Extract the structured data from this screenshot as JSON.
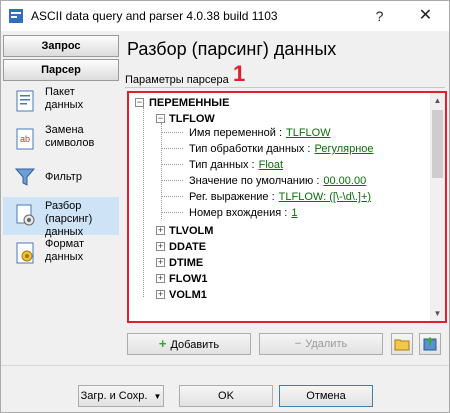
{
  "window": {
    "title": "ASCII data query and parser 4.0.38 build 1103",
    "help_glyph": "?",
    "close_glyph": "✕"
  },
  "sidebar": {
    "tabs": [
      {
        "label": "Запрос"
      },
      {
        "label": "Парсер"
      }
    ],
    "items": [
      {
        "label": "Пакет\nданных",
        "icon": "data-packet-icon"
      },
      {
        "label": "Замена\nсимволов",
        "icon": "replace-chars-icon"
      },
      {
        "label": "Фильтр",
        "icon": "filter-icon"
      },
      {
        "label": "Разбор\n(парсинг)\nданных",
        "icon": "parsing-icon",
        "active": true
      },
      {
        "label": "Формат\nданных",
        "icon": "data-format-icon"
      }
    ]
  },
  "main": {
    "heading": "Разбор (парсинг) данных",
    "group_label": "Параметры парсера",
    "marker": "1"
  },
  "tree": {
    "root": {
      "label": "ПЕРЕМЕННЫЕ",
      "expander": "−"
    },
    "expanded": {
      "label": "TLFLOW",
      "expander": "−"
    },
    "props": [
      {
        "name": "Имя переменной :",
        "value": "TLFLOW"
      },
      {
        "name": "Тип обработки данных :",
        "value": "Регулярное"
      },
      {
        "name": "Тип данных :",
        "value": "Float"
      },
      {
        "name": "Значение по умолчанию :",
        "value": "00.00.00"
      },
      {
        "name": "Рег. выражение :",
        "value": "TLFLOW: ([\\-\\d\\.]+)"
      },
      {
        "name": "Номер вхождения :",
        "value": "1"
      }
    ],
    "collapsed": [
      {
        "label": "TLVOLM",
        "expander": "+"
      },
      {
        "label": "DDATE",
        "expander": "+"
      },
      {
        "label": "DTIME",
        "expander": "+"
      },
      {
        "label": "FLOW1",
        "expander": "+"
      },
      {
        "label": "VOLM1",
        "expander": "+"
      }
    ]
  },
  "actions": {
    "add": "Добавить",
    "delete": "Удалить",
    "add_glyph": "+",
    "delete_glyph": "−"
  },
  "footer": {
    "load_save": "Загр. и Сохр.",
    "load_save_arrow": "▼",
    "ok": "OK",
    "cancel": "Отмена"
  },
  "colors": {
    "highlight": "#e0202e",
    "value_link": "#0a6e0a",
    "active_item": "#cfe3f7"
  }
}
